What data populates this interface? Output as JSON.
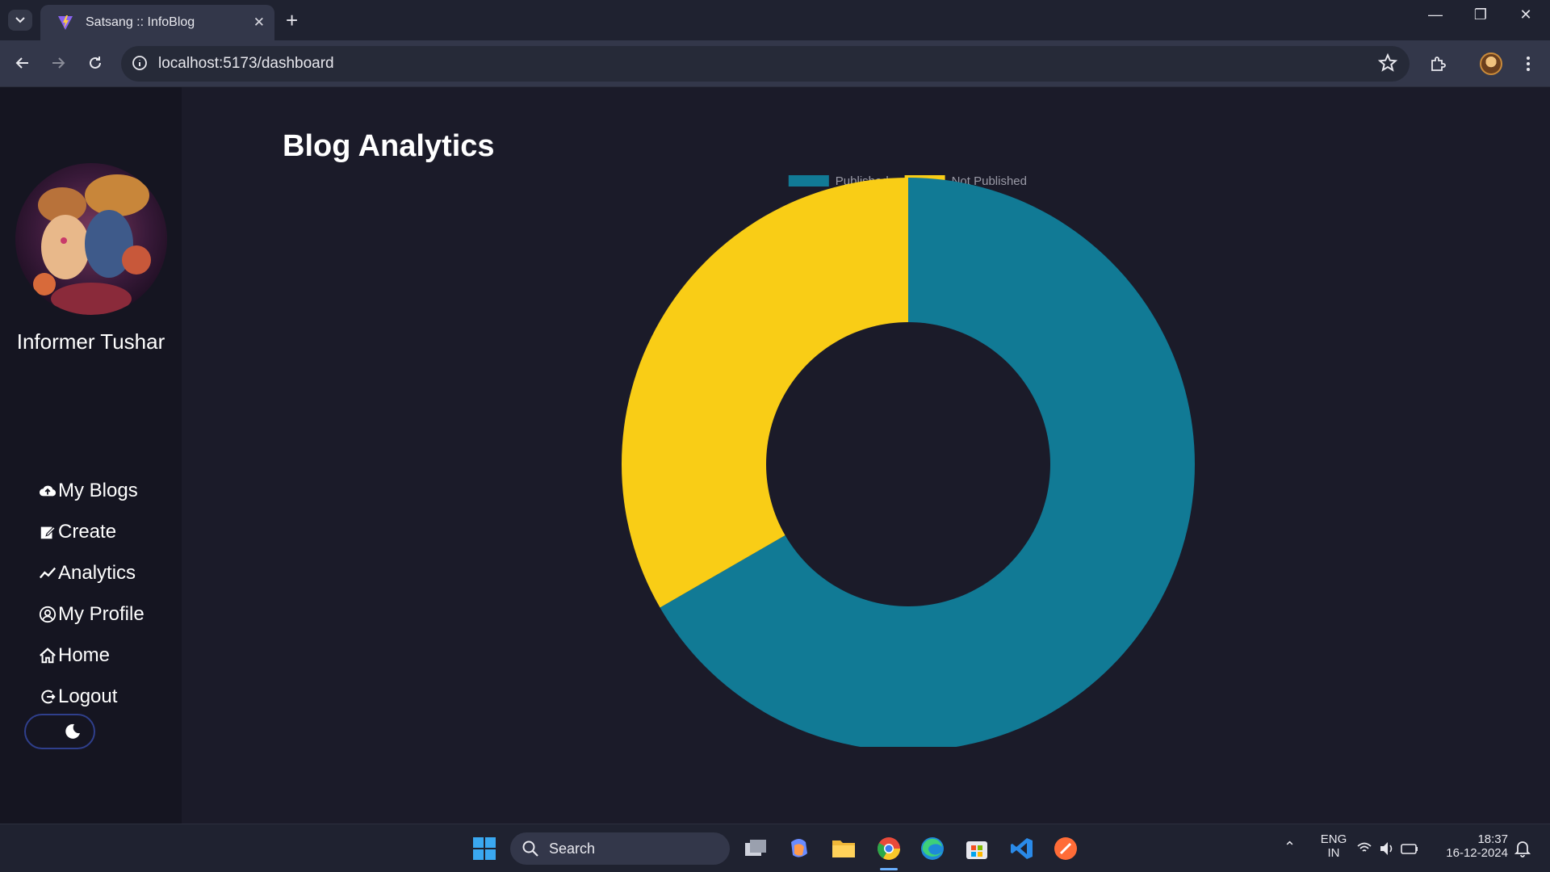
{
  "browser": {
    "tab_title": "Satsang :: InfoBlog",
    "url": "localhost:5173/dashboard"
  },
  "sidebar": {
    "user_name": "Informer Tushar",
    "items": [
      {
        "label": "My Blogs",
        "icon": "cloud-upload-icon"
      },
      {
        "label": "Create",
        "icon": "edit-icon"
      },
      {
        "label": "Analytics",
        "icon": "trend-icon"
      },
      {
        "label": "My Profile",
        "icon": "user-circle-icon"
      },
      {
        "label": "Home",
        "icon": "home-icon"
      },
      {
        "label": "Logout",
        "icon": "logout-icon"
      }
    ],
    "theme_toggle_icon": "moon-icon"
  },
  "main": {
    "title": "Blog Analytics"
  },
  "chart_data": {
    "type": "doughnut",
    "series": [
      {
        "name": "Published",
        "value": 2,
        "color": "#117a95"
      },
      {
        "name": "Not Published",
        "value": 1,
        "color": "#f9cd16"
      }
    ],
    "legend_position": "top"
  },
  "taskbar": {
    "search_label": "Search",
    "lang_line1": "ENG",
    "lang_line2": "IN",
    "time": "18:37",
    "date": "16-12-2024"
  }
}
